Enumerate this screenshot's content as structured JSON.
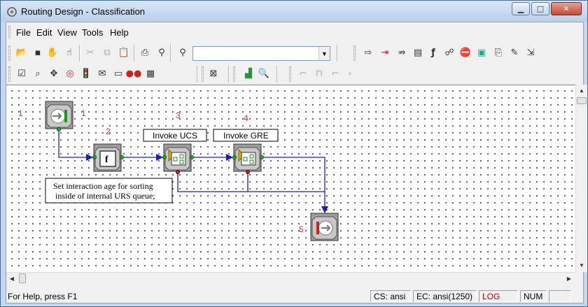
{
  "window": {
    "title": "Routing Design - Classification"
  },
  "menu": [
    "File",
    "Edit",
    "View",
    "Tools",
    "Help"
  ],
  "toolbar1_icons": [
    "open-icon",
    "save-icon",
    "hand-icon",
    "hand-select-icon",
    "cut-icon",
    "copy-icon",
    "paste-icon",
    "print-icon",
    "find-icon",
    "find-next-icon"
  ],
  "toolbar_search": {
    "value": ""
  },
  "toolbar1_right_icons": [
    "entry-icon",
    "exit-icon",
    "route-icon",
    "list-icon",
    "function-icon",
    "graph-icon",
    "stop-sign-icon",
    "screen-icon",
    "export-icon",
    "pen-icon",
    "import-icon"
  ],
  "toolbar2_icons": [
    "verify-icon",
    "zoom-icon",
    "move-icon",
    "target-icon",
    "traffic-light-icon",
    "mail-icon",
    "chat-icon",
    "pair-icon",
    "group-icon",
    "script-icon",
    "chart-icon",
    "check-icon",
    "disabled-a-icon",
    "disabled-b-icon",
    "disabled-c-icon",
    "disabled-d-icon"
  ],
  "diagram": {
    "nodes": [
      {
        "id": "1",
        "type": "entry",
        "label": "1",
        "sublabel": "1"
      },
      {
        "id": "2",
        "type": "function",
        "label": "2",
        "glyph": "f"
      },
      {
        "id": "3",
        "type": "subroutine",
        "label": "3",
        "caption": "Invoke UCS"
      },
      {
        "id": "4",
        "type": "subroutine",
        "label": "4",
        "caption": "Invoke GRE"
      },
      {
        "id": "5",
        "type": "exit",
        "label": "5"
      }
    ],
    "note_lines": [
      "Set interaction age for sorting",
      "inside of internal URS queue;"
    ]
  },
  "status": {
    "help": "For Help, press F1",
    "cs": "CS: ansi",
    "ec": "EC: ansi(1250)",
    "log": "LOG",
    "num": "NUM"
  },
  "colors": {
    "link": "#1a1acc",
    "number": "#cc3333",
    "log": "#cc0000"
  }
}
